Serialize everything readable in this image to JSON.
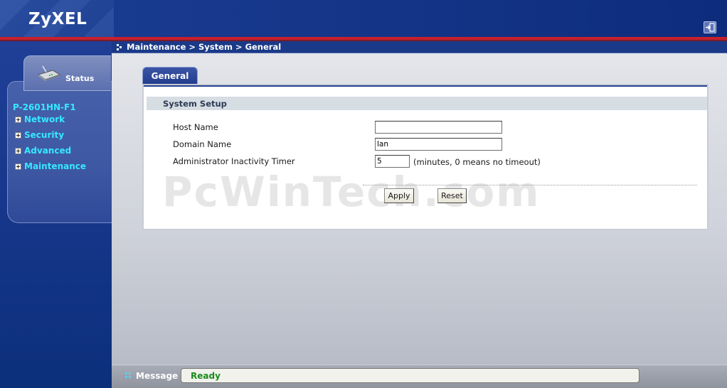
{
  "header": {
    "brand": "ZyXEL"
  },
  "breadcrumb": "Maintenance > System > General",
  "nav": {
    "status_label": "Status",
    "device": "P-2601HN-F1",
    "items": [
      {
        "label": "Network"
      },
      {
        "label": "Security"
      },
      {
        "label": "Advanced"
      },
      {
        "label": "Maintenance"
      }
    ]
  },
  "tab": {
    "label": "General"
  },
  "section": {
    "title": "System Setup"
  },
  "form": {
    "host_name": {
      "label": "Host Name",
      "value": ""
    },
    "domain_name": {
      "label": "Domain Name",
      "value": "lan"
    },
    "inactivity_timer": {
      "label": "Administrator Inactivity Timer",
      "value": "5",
      "hint": "(minutes, 0 means no timeout)"
    }
  },
  "buttons": {
    "apply": "Apply",
    "reset": "Reset"
  },
  "watermark": "PcWinTech.com",
  "message": {
    "label": "Message",
    "status": "Ready",
    "status_color": "#1b8a1b"
  },
  "icons": {
    "logout": "logout-icon",
    "router": "router-icon",
    "breadcrumb": "arrow-icon",
    "message": "message-dots-icon"
  },
  "colors": {
    "accent": "#37e8ff",
    "header_red": "#c8202c",
    "nav_blue": "#17378c"
  }
}
